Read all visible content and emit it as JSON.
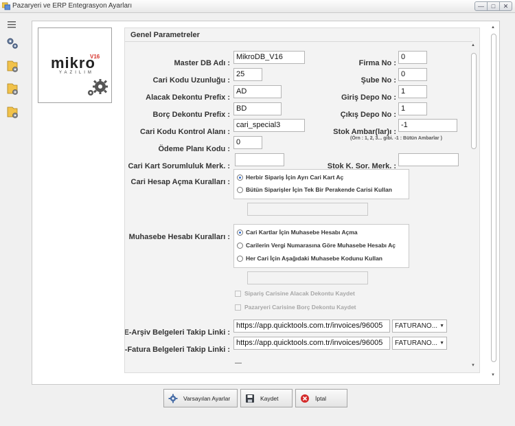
{
  "window": {
    "title": "Pazaryeri ve ERP Entegrasyon Ayarları",
    "controls": {
      "minimize": "—",
      "maximize": "□",
      "close": "✕"
    }
  },
  "sidebar": {
    "icons": [
      "hamburger-menu-icon",
      "gears-icon",
      "settings-folder-icon",
      "settings-folder-icon",
      "settings-folder-icon"
    ]
  },
  "logo": {
    "brand": "mikro",
    "version": "V16",
    "subtitle": "YAZILIM"
  },
  "panel": {
    "title": "Genel Parametreler",
    "fields": {
      "master_db": {
        "label": "Master DB Adı :",
        "value": "MikroDB_V16"
      },
      "firma_no": {
        "label": "Firma No :",
        "value": "0"
      },
      "cari_kodu_uzunlugu": {
        "label": "Cari Kodu Uzunluğu :",
        "value": "25"
      },
      "sube_no": {
        "label": "Şube No :",
        "value": "0"
      },
      "alacak_dekontu_prefix": {
        "label": "Alacak Dekontu Prefix :",
        "value": "AD"
      },
      "giris_depo_no": {
        "label": "Giriş Depo No :",
        "value": "1"
      },
      "borc_dekontu_prefix": {
        "label": "Borç Dekontu Prefix :",
        "value": "BD"
      },
      "cikis_depo_no": {
        "label": "Çıkış Depo No :",
        "value": "1"
      },
      "cari_kodu_kontrol_alani": {
        "label": "Cari Kodu Kontrol Alanı :",
        "value": "cari_special3"
      },
      "stok_ambarlari": {
        "label": "Stok Ambar(lar)ı :",
        "value": "-1",
        "hint": "(Örn : 1, 2, 3... gibi. -1 : Bütün Ambarlar )"
      },
      "odeme_plani_kodu": {
        "label": "Ödeme Planı Kodu :",
        "value": "0"
      },
      "cari_kart_sorumluluk": {
        "label": "Cari Kart Sorumluluk Merk. :",
        "value": ""
      },
      "stok_sor_merk": {
        "label": "Stok K.  Sor. Merk. :",
        "value": ""
      }
    },
    "cari_hesap": {
      "label": "Cari Hesap Açma Kuralları :",
      "options": [
        "Herbir Sipariş İçin Ayrı Cari Kart Aç",
        "Bütün Siparişler İçin Tek Bir Perakende Carisi Kullan"
      ],
      "selected": 0,
      "extra_value": ""
    },
    "muhasebe": {
      "label": "Muhasebe Hesabı Kuralları :",
      "options": [
        "Cari Kartlar İçin Muhasebe Hesabı Açma",
        "Carilerin Vergi Numarasına Göre Muhasebe Hesabı Aç",
        "Her Cari İçin Aşağıdaki Muhasebe Kodunu Kullan"
      ],
      "selected": 0,
      "extra_value": ""
    },
    "checkboxes": [
      {
        "label": "Sipariş Carisine Alacak Dekontu Kaydet",
        "checked": false,
        "enabled": false
      },
      {
        "label": "Pazaryeri Carisine Borç Dekontu Kaydet",
        "checked": false,
        "enabled": false
      }
    ],
    "links": {
      "earsiv": {
        "label": "E-Arşiv Belgeleri Takip Linki :",
        "value": "https://app.quicktools.com.tr/invoices/96005",
        "combo": "FATURANO..."
      },
      "efatura": {
        "label": "E-Fatura Belgeleri Takip Linki :",
        "value": "https://app.quicktools.com.tr/invoices/96005",
        "combo": "FATURANO..."
      }
    },
    "partial_row_text": "—"
  },
  "buttons": {
    "defaults": "Varsayılan Ayarlar",
    "save": "Kaydet",
    "cancel": "İptal"
  },
  "colors": {
    "logo_red": "#d6322b",
    "radio_blue": "#2a6ad0",
    "cancel_red": "#d42a2a"
  }
}
